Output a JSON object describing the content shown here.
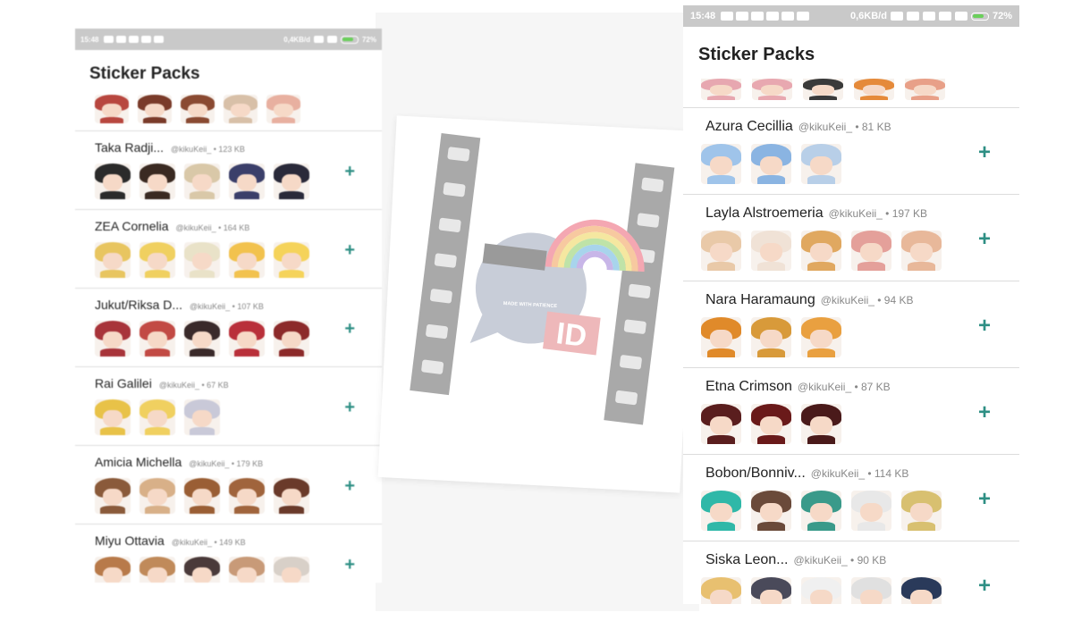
{
  "left_screen": {
    "status": {
      "time": "15:48",
      "speed": "0,4KB/d",
      "battery": "72%"
    },
    "title": "Sticker Packs",
    "top_row_stickers": [
      "#b8473f",
      "#7a3b2a",
      "#8a4a32",
      "#d8c0a8",
      "#e8b0a0"
    ],
    "packs": [
      {
        "name": "Taka Radji...",
        "meta": "@kikuKeii_ • 123 KB",
        "stickers": [
          "#2b2b2b",
          "#3a2a22",
          "#d9c8a8",
          "#3b3f6a",
          "#2a2a3a"
        ]
      },
      {
        "name": "ZEA Cornelia",
        "meta": "@kikuKeii_ • 164 KB",
        "stickers": [
          "#e8c560",
          "#f0d060",
          "#e9e2c8",
          "#f2c24e",
          "#f5d35a"
        ]
      },
      {
        "name": "Jukut/Riksa D...",
        "meta": "@kikuKeii_ • 107 KB",
        "stickers": [
          "#a8343a",
          "#c24a44",
          "#3a2a2a",
          "#b9303a",
          "#8c2a2a"
        ]
      },
      {
        "name": "Rai Galilei",
        "meta": "@kikuKeii_ • 67 KB",
        "stickers": [
          "#e8c248",
          "#f0d060",
          "#c9c9d8"
        ]
      },
      {
        "name": "Amicia Michella",
        "meta": "@kikuKeii_ • 179 KB",
        "stickers": [
          "#8a5a3a",
          "#d8b088",
          "#9a5e34",
          "#a0643c",
          "#6a3a2a"
        ]
      },
      {
        "name": "Miyu Ottavia",
        "meta": "@kikuKeii_ • 149 KB",
        "stickers": [
          "#b87a4a",
          "#c08a5a",
          "#4a3a3a",
          "#c89a78",
          "#d8d0c8"
        ]
      }
    ],
    "add_label": "+"
  },
  "right_screen": {
    "status": {
      "time": "15:48",
      "speed": "0,6KB/d",
      "battery": "72%"
    },
    "title": "Sticker Packs",
    "top_row_stickers": [
      "#e7a7b0",
      "#e8a8b0",
      "#3a3a3a",
      "#e58a3a",
      "#e8a088"
    ],
    "packs": [
      {
        "name": "Azura Cecillia",
        "meta": "@kikuKeii_ • 81 KB",
        "stickers": [
          "#9fc4ea",
          "#8ab4e2",
          "#b8cfe8"
        ]
      },
      {
        "name": "Layla Alstroemeria",
        "meta": "@kikuKeii_ • 197 KB",
        "stickers": [
          "#e9c9a8",
          "#f0e2d6",
          "#e0a860",
          "#e4a09a",
          "#e8b89a"
        ]
      },
      {
        "name": "Nara Haramaung",
        "meta": "@kikuKeii_ • 94 KB",
        "stickers": [
          "#e08a2a",
          "#d89a3a",
          "#e9a040"
        ]
      },
      {
        "name": "Etna Crimson",
        "meta": "@kikuKeii_ • 87 KB",
        "stickers": [
          "#5a1e1e",
          "#6a1a1a",
          "#4a1a1a"
        ]
      },
      {
        "name": "Bobon/Bonniv...",
        "meta": "@kikuKeii_ • 114 KB",
        "stickers": [
          "#2fb8a8",
          "#6a4a3a",
          "#3a9a8a",
          "#e8e8e8",
          "#d8c070"
        ]
      },
      {
        "name": "Siska Leon...",
        "meta": "@kikuKeii_ • 90 KB",
        "stickers": [
          "#e8c070",
          "#4a4a5a",
          "#f0f0f0",
          "#e0e0e0",
          "#2a3a5a"
        ]
      }
    ],
    "add_label": "+"
  },
  "logo": {
    "tagline": "MADE WITH PATIENCE",
    "badge": "ID",
    "colors": {
      "film": "#a9a9a9",
      "bubble": "#c8cdd8",
      "badge": "#eeb8ba",
      "bar": "#9a9a9a"
    }
  }
}
